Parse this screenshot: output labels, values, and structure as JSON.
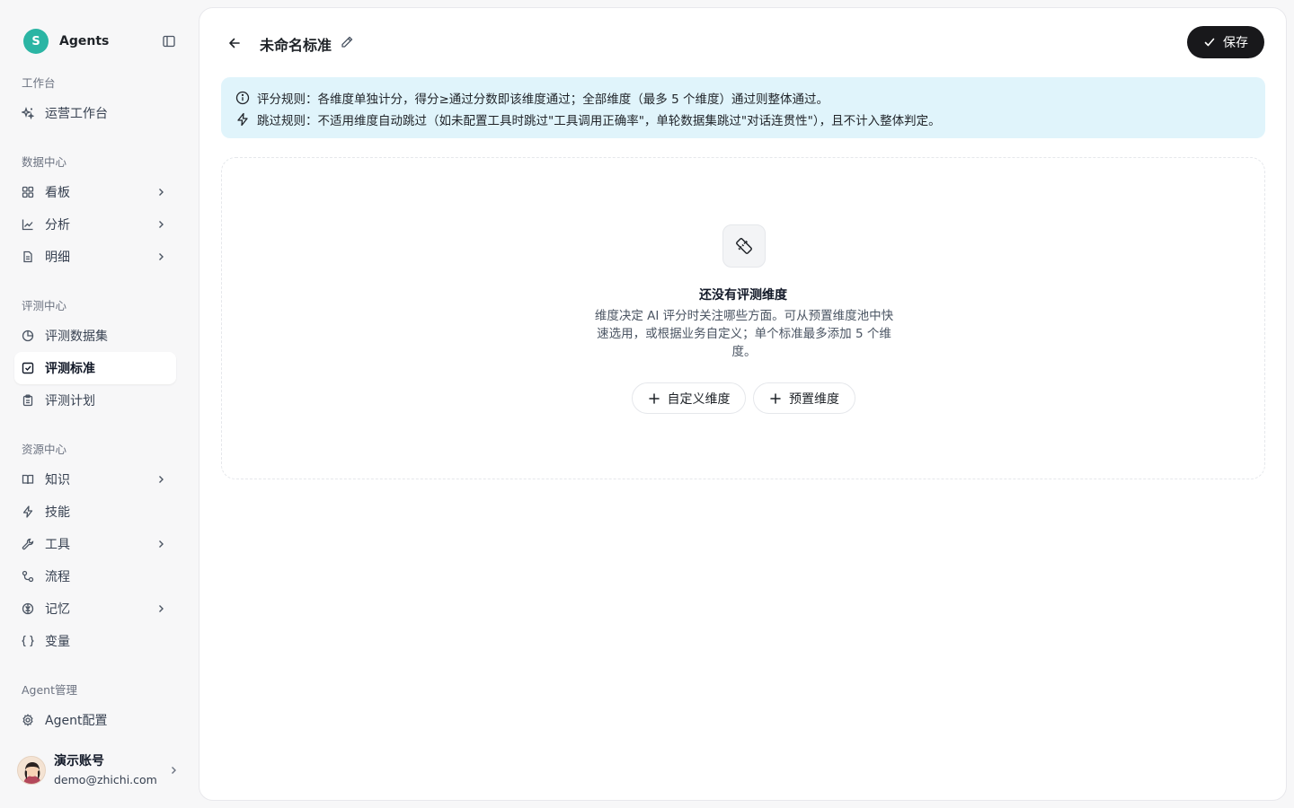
{
  "sidebar": {
    "brand": {
      "logo_letter": "S",
      "name": "Agents",
      "logo_color": "#2bb5a4"
    },
    "groups": {
      "workspace": "工作台",
      "data_center": "数据中心",
      "eval_center": "评测中心",
      "resource_center": "资源中心",
      "agent_mgmt": "Agent管理"
    },
    "items": {
      "ops": "运营工作台",
      "board": "看板",
      "analysis": "分析",
      "detail": "明细",
      "dataset": "评测数据集",
      "standard": "评测标准",
      "plan": "评测计划",
      "knowledge": "知识",
      "skills": "技能",
      "tools": "工具",
      "flow": "流程",
      "memory": "记忆",
      "variables": "变量",
      "agent_config": "Agent配置"
    },
    "active_item": "评测标准",
    "user": {
      "name": "演示账号",
      "email": "demo@zhichi.com"
    }
  },
  "header": {
    "title": "未命名标准",
    "save_label": "保存"
  },
  "rules": {
    "scoring": "评分规则：各维度单独计分，得分≥通过分数即该维度通过；全部维度（最多 5 个维度）通过则整体通过。",
    "skip": "跳过规则：不适用维度自动跳过（如未配置工具时跳过\"工具调用正确率\"，单轮数据集跳过\"对话连贯性\"），且不计入整体判定。"
  },
  "empty_state": {
    "title": "还没有评测维度",
    "description": "维度决定 AI 评分时关注哪些方面。可从预置维度池中快速选用，或根据业务自定义；单个标准最多添加 5 个维度。",
    "custom_button": "自定义维度",
    "preset_button": "预置维度"
  },
  "colors": {
    "accent": "#18181b",
    "info_bg": "#e0f4fb"
  }
}
